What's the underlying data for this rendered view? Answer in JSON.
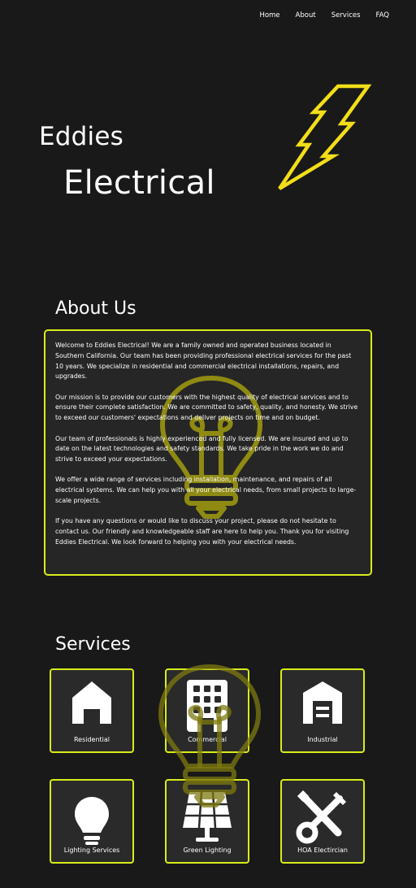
{
  "nav": {
    "items": [
      "Home",
      "About",
      "Services",
      "FAQ"
    ]
  },
  "hero": {
    "line1": "Eddies",
    "line2": "Electrical"
  },
  "about": {
    "heading": "About Us",
    "paragraphs": [
      "Welcome to Eddies Electrical! We are a family owned and operated business located in Southern California. Our team has been providing professional electrical services for the past 10 years. We specialize in residential and commercial electrical installations, repairs, and upgrades.",
      "Our mission is to provide our customers with the highest quality of electrical services and to ensure their complete satisfaction. We are committed to safety, quality, and honesty. We strive to exceed our customers' expectations and deliver projects on time and on budget.",
      "Our team of professionals is highly experienced and fully licensed. We are insured and up to date on the latest technologies and safety standards. We take pride in the work we do and strive to exceed your expectations.",
      "We offer a wide range of services including installation, maintenance, and repairs of all electrical systems. We can help you with all your electrical needs, from small projects to large-scale projects.",
      "If you have any questions or would like to discuss your project, please do not hesitate to contact us. Our friendly and knowledgeable staff are here to help you. Thank you for visiting Eddies Electrical. We look forward to helping you with your electrical needs."
    ]
  },
  "services": {
    "heading": "Services",
    "items": [
      {
        "label": "Residential",
        "icon": "house-icon"
      },
      {
        "label": "Commercial",
        "icon": "building-icon"
      },
      {
        "label": "Industrial",
        "icon": "warehouse-icon"
      },
      {
        "label": "Lighting Services",
        "icon": "lightbulb-icon"
      },
      {
        "label": "Green Lighting",
        "icon": "solar-panel-icon"
      },
      {
        "label": "HOA Electircian",
        "icon": "tools-icon"
      }
    ]
  },
  "colors": {
    "accent": "#d7ec19",
    "bolt": "#f2de19",
    "background": "#191919"
  }
}
